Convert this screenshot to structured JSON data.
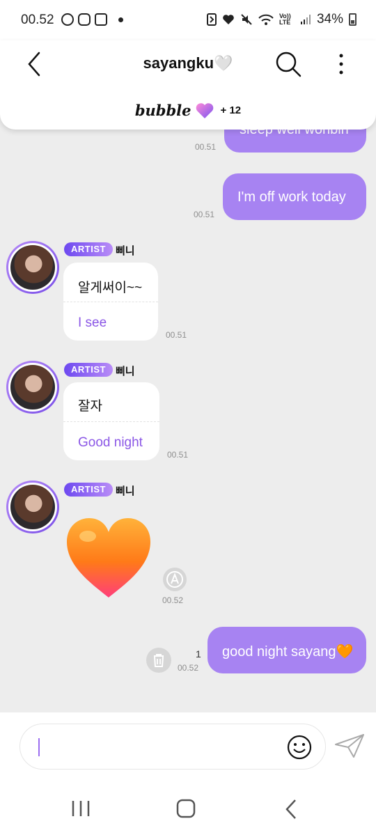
{
  "status_bar": {
    "time": "00.52",
    "battery": "34%",
    "network": "Vo)) LTE",
    "left_icons": [
      "whatsapp-icon",
      "line-icon",
      "instagram-icon"
    ],
    "right_icons": [
      "nfc-icon",
      "heart-icon",
      "mute-icon",
      "wifi-icon",
      "signal-icon",
      "battery-icon"
    ]
  },
  "header": {
    "title": "sayangku🤍",
    "brand": "bubble",
    "count": "+ 12"
  },
  "colors": {
    "accent": "#a783f2",
    "translation": "#8b57e6",
    "background": "#ededed"
  },
  "messages": [
    {
      "text": "sleep well wonbin",
      "time": "00.51"
    },
    {
      "text": "I'm off work today",
      "time": "00.51"
    },
    {
      "badge": "ARTIST",
      "name": "삐니",
      "text": "알게써이~~",
      "translation": "I see",
      "time": "00.51"
    },
    {
      "badge": "ARTIST",
      "name": "삐니",
      "text": "잘자",
      "translation": "Good night",
      "time": "00.51"
    },
    {
      "badge": "ARTIST",
      "name": "삐니",
      "emoji": "orange-heart",
      "time": "00.52"
    },
    {
      "text": "good night sayang🧡",
      "time": "00.52",
      "unread": "1"
    }
  ],
  "input": {
    "placeholder": ""
  }
}
